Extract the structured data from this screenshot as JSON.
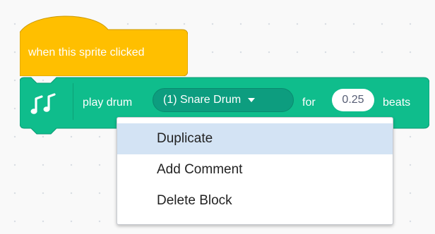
{
  "colors": {
    "event_block": "#ffbf00",
    "event_block_edge": "#cc9900",
    "music_block": "#0fbd8c",
    "music_block_edge": "#0b9a73",
    "menu_highlight": "#d3e3f4"
  },
  "event_block": {
    "label": "when this sprite clicked"
  },
  "music_block": {
    "icon": "music-notes-icon",
    "text_play_drum": "play drum",
    "drum_selected": "(1) Snare Drum",
    "text_for": "for",
    "beats_value": "0.25",
    "text_beats": "beats"
  },
  "context_menu": {
    "items": [
      {
        "label": "Duplicate",
        "highlighted": true
      },
      {
        "label": "Add Comment",
        "highlighted": false
      },
      {
        "label": "Delete Block",
        "highlighted": false
      }
    ]
  }
}
